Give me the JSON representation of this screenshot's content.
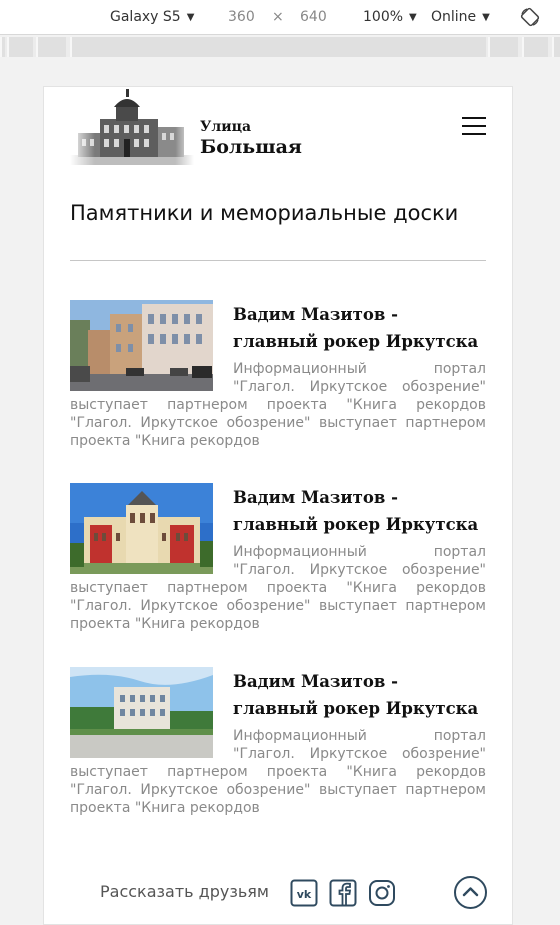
{
  "devtools": {
    "device": "Galaxy S5",
    "width": "360",
    "times": "×",
    "height": "640",
    "zoom": "100%",
    "network": "Online"
  },
  "header": {
    "logo_small": "Улица",
    "logo_big": "Большая"
  },
  "page_title": "Памятники и мемориальные доски",
  "articles": [
    {
      "title": "Вадим Мазитов - главный рокер Иркутска",
      "excerpt": "Информационный портал \"Глагол. Иркутское обозрение\" выступает партнером проекта \"Книга рекордов \"Глагол. Иркутское обозрение\" выступает партнером проекта \"Книга рекордов",
      "image": "street-photo"
    },
    {
      "title": "Вадим Мазитов - главный рокер Иркутска",
      "excerpt": "Информационный портал \"Глагол. Иркутское обозрение\" выступает партнером проекта \"Книга рекордов \"Глагол. Иркутское обозрение\" выступает партнером проекта \"Книга рекордов",
      "image": "theatre-photo"
    },
    {
      "title": "Вадим Мазитов - главный рокер Иркутска",
      "excerpt": "Информационный портал \"Глагол. Иркутское обозрение\" выступает партнером проекта \"Книга рекордов \"Глагол. Иркутское обозрение\" выступает партнером проекта \"Книга рекордов",
      "image": "square-photo"
    }
  ],
  "footer": {
    "share_label": "Рассказать друзьям",
    "social_icons": [
      "vk-icon",
      "facebook-icon",
      "instagram-icon"
    ],
    "up_icon": "chevron-up-icon"
  },
  "colors": {
    "accent_dark": "#2f4a5f",
    "text_muted": "#8a8a8a"
  }
}
